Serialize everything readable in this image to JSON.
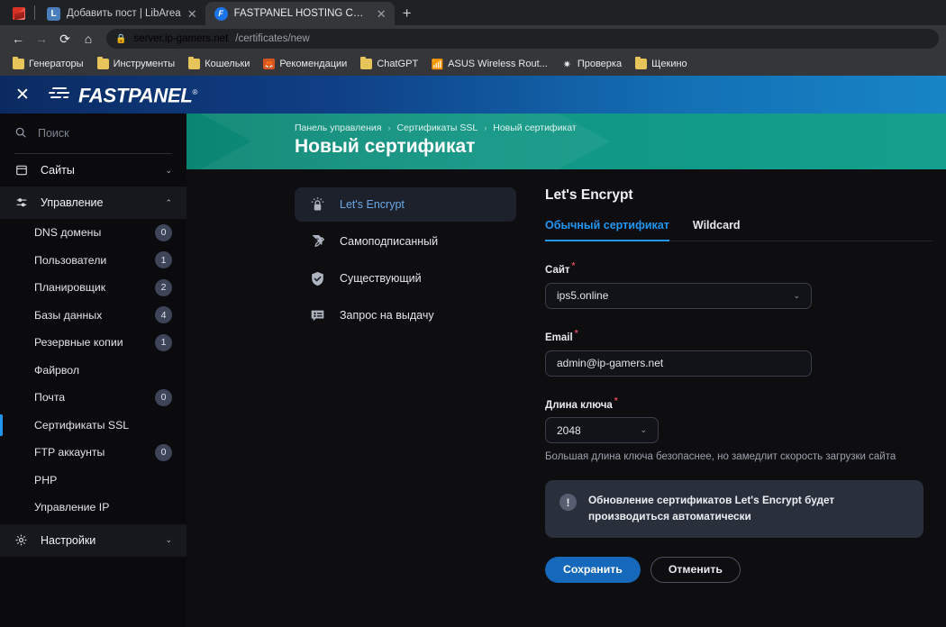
{
  "browser": {
    "tabs": [
      {
        "title": "Добавить пост | LibArea",
        "favicon": "libarea-icon",
        "active": false
      },
      {
        "title": "FASTPANEL HOSTING CONTROL",
        "favicon": "fastpanel-icon",
        "active": true
      }
    ],
    "new_tab_label": "+",
    "nav": {
      "back": "←",
      "forward": "→",
      "reload": "⟳",
      "home": "⌂"
    },
    "omnibox": {
      "lock_icon": "lock-icon",
      "host": "server.ip-gamers.net",
      "path": "/certificates/new"
    },
    "bookmarks": [
      {
        "label": "Генераторы",
        "icon": "folder-icon"
      },
      {
        "label": "Инструменты",
        "icon": "folder-icon"
      },
      {
        "label": "Кошельки",
        "icon": "folder-icon"
      },
      {
        "label": "Рекомендации",
        "icon": "firefox-icon"
      },
      {
        "label": "ChatGPT",
        "icon": "folder-icon"
      },
      {
        "label": "ASUS Wireless Rout...",
        "icon": "wifi-icon"
      },
      {
        "label": "Проверка",
        "icon": "gear-icon"
      },
      {
        "label": "Щекино",
        "icon": "folder-icon"
      }
    ]
  },
  "app_header": {
    "close_label": "✕",
    "brand": "FASTPANEL",
    "brand_mark": "®"
  },
  "sidebar": {
    "search_placeholder": "Поиск",
    "groups": [
      {
        "label": "Сайты",
        "icon": "window-icon",
        "expanded": false,
        "chevron": "⌄"
      },
      {
        "label": "Управление",
        "icon": "sliders-icon",
        "expanded": true,
        "chevron": "⌃"
      }
    ],
    "items": [
      {
        "label": "DNS домены",
        "badge": "0",
        "active": false
      },
      {
        "label": "Пользователи",
        "badge": "1",
        "active": false
      },
      {
        "label": "Планировщик",
        "badge": "2",
        "active": false
      },
      {
        "label": "Базы данных",
        "badge": "4",
        "active": false
      },
      {
        "label": "Резервные копии",
        "badge": "1",
        "active": false
      },
      {
        "label": "Файрвол",
        "badge": "",
        "active": false
      },
      {
        "label": "Почта",
        "badge": "0",
        "active": false
      },
      {
        "label": "Сертификаты SSL",
        "badge": "",
        "active": true
      },
      {
        "label": "FTP аккаунты",
        "badge": "0",
        "active": false
      },
      {
        "label": "PHP",
        "badge": "",
        "active": false
      },
      {
        "label": "Управление IP",
        "badge": "",
        "active": false
      }
    ],
    "settings": {
      "label": "Настройки",
      "icon": "gear-icon",
      "chevron": "⌄"
    }
  },
  "page": {
    "breadcrumb": [
      "Панель управления",
      "Сертификаты SSL",
      "Новый сертификат"
    ],
    "breadcrumb_separator": "›",
    "title": "Новый сертификат"
  },
  "cert_types": [
    {
      "label": "Let's Encrypt",
      "icon": "lock-shine-icon",
      "selected": true
    },
    {
      "label": "Самоподписанный",
      "icon": "document-pen-icon",
      "selected": false
    },
    {
      "label": "Существующий",
      "icon": "shield-check-icon",
      "selected": false
    },
    {
      "label": "Запрос на выдачу",
      "icon": "certificate-request-icon",
      "selected": false
    }
  ],
  "form": {
    "title": "Let's Encrypt",
    "tabs": [
      {
        "label": "Обычный сертификат",
        "active": true
      },
      {
        "label": "Wildcard",
        "active": false
      }
    ],
    "fields": {
      "site": {
        "label": "Сайт",
        "required_mark": "*",
        "value": "ips5.online",
        "caret": "⌄"
      },
      "email": {
        "label": "Email",
        "required_mark": "*",
        "value": "admin@ip-gamers.net"
      },
      "key_length": {
        "label": "Длина ключа",
        "required_mark": "*",
        "value": "2048",
        "caret": "⌄",
        "hint": "Большая длина ключа безопаснее, но замедлит скорость загрузки сайта"
      }
    },
    "notice": {
      "icon_glyph": "!",
      "text": "Обновление сертификатов Let's Encrypt будет производиться автоматически"
    },
    "buttons": {
      "save": "Сохранить",
      "cancel": "Отменить"
    }
  },
  "colors": {
    "accent_blue": "#2196f3",
    "primary_button": "#1668ba",
    "header_gradient_start": "#0b2a61",
    "header_gradient_end": "#1785c6",
    "page_head_teal": "#109684",
    "required_red": "#e04a5f",
    "badge_bg": "#3e4559"
  }
}
